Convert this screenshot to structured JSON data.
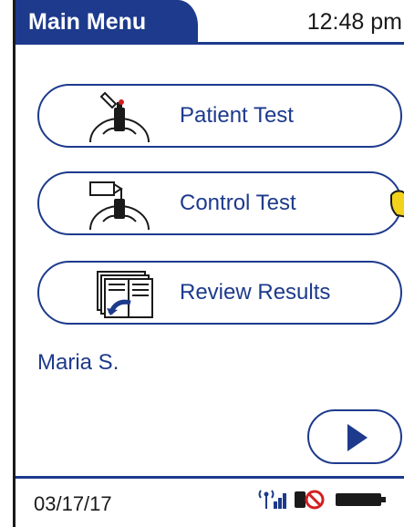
{
  "header": {
    "title": "Main Menu",
    "time": "12:48 pm"
  },
  "menu": {
    "items": [
      {
        "label": "Patient Test",
        "icon": "patient-test-icon"
      },
      {
        "label": "Control Test",
        "icon": "control-test-icon"
      },
      {
        "label": "Review Results",
        "icon": "review-results-icon"
      }
    ]
  },
  "user": {
    "name": "Maria S."
  },
  "footer": {
    "date": "03/17/17"
  },
  "colors": {
    "accent": "#1d3a8c",
    "text": "#1a1a1a",
    "background": "#ffffff",
    "pointer": "#f2d21a"
  }
}
